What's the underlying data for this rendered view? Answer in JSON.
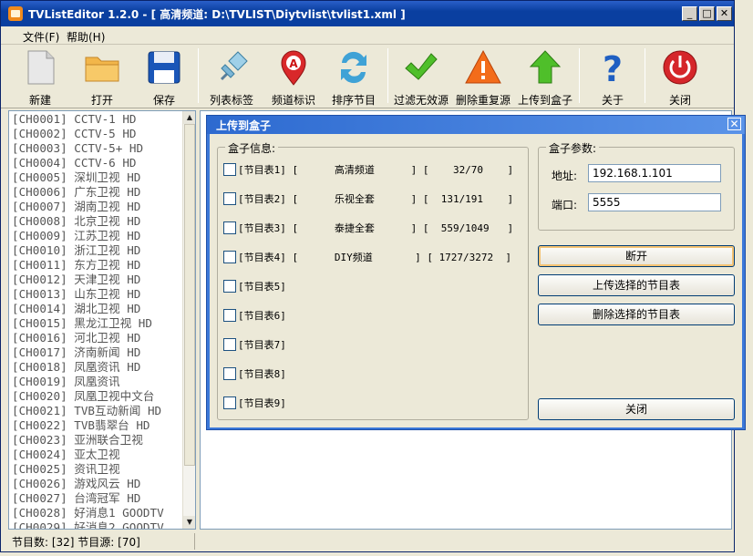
{
  "window": {
    "title": "TVListEditor 1.2.0 - [ 高清频道: D:\\TVLIST\\Diytvlist\\tvlist1.xml ]"
  },
  "menu": [
    {
      "label": "文件(F)"
    },
    {
      "label": "帮助(H)"
    }
  ],
  "toolbar": [
    {
      "label": "新建",
      "icon": "new-file-icon"
    },
    {
      "label": "打开",
      "icon": "open-folder-icon"
    },
    {
      "label": "保存",
      "icon": "save-disk-icon"
    },
    {
      "label": "列表标签",
      "icon": "pin-icon"
    },
    {
      "label": "频道标识",
      "icon": "marker-a-icon"
    },
    {
      "label": "排序节目",
      "icon": "sort-arrows-icon"
    },
    {
      "label": "过滤无效源",
      "icon": "checkmark-icon"
    },
    {
      "label": "删除重复源",
      "icon": "warning-icon"
    },
    {
      "label": "上传到盒子",
      "icon": "upload-arrow-icon"
    },
    {
      "label": "关于",
      "icon": "help-icon"
    },
    {
      "label": "关闭",
      "icon": "power-icon"
    }
  ],
  "channels": [
    "[CH0001] CCTV-1 HD",
    "[CH0002] CCTV-5 HD",
    "[CH0003] CCTV-5+ HD",
    "[CH0004] CCTV-6 HD",
    "[CH0005] 深圳卫视 HD",
    "[CH0006] 广东卫视 HD",
    "[CH0007] 湖南卫视 HD",
    "[CH0008] 北京卫视 HD",
    "[CH0009] 江苏卫视 HD",
    "[CH0010] 浙江卫视 HD",
    "[CH0011] 东方卫视 HD",
    "[CH0012] 天津卫视 HD",
    "[CH0013] 山东卫视 HD",
    "[CH0014] 湖北卫视 HD",
    "[CH0015] 黑龙江卫视 HD",
    "[CH0016] 河北卫视 HD",
    "[CH0017] 济南新闻 HD",
    "[CH0018] 凤凰资讯 HD",
    "[CH0019] 凤凰资讯",
    "[CH0020] 凤凰卫视中文台",
    "[CH0021] TVB互动新闻 HD",
    "[CH0022] TVB翡翠台 HD",
    "[CH0023] 亚洲联合卫视",
    "[CH0024] 亚太卫视",
    "[CH0025] 资讯卫视",
    "[CH0026] 游戏风云 HD",
    "[CH0027] 台湾冠军 HD",
    "[CH0028] 好消息1 GOODTV",
    "[CH0029] 好消息2 GOODTV"
  ],
  "status": {
    "text": "节目数: [32]  节目源: [70]"
  },
  "dialog": {
    "title": "上传到盒子",
    "box_info_title": "盒子信息:",
    "box_params_title": "盒子参数:",
    "lists": [
      {
        "label": "[节目表1] [      高清频道      ] [    32/70    ]",
        "checked": false
      },
      {
        "label": "[节目表2] [      乐视全套      ] [  131/191    ]",
        "checked": false
      },
      {
        "label": "[节目表3] [      泰捷全套      ] [  559/1049   ]",
        "checked": false
      },
      {
        "label": "[节目表4] [      DIY频道       ] [ 1727/3272  ]",
        "checked": false
      },
      {
        "label": "[节目表5]",
        "checked": false
      },
      {
        "label": "[节目表6]",
        "checked": false
      },
      {
        "label": "[节目表7]",
        "checked": false
      },
      {
        "label": "[节目表8]",
        "checked": false
      },
      {
        "label": "[节目表9]",
        "checked": false
      }
    ],
    "address_label": "地址:",
    "address_value": "192.168.1.101",
    "port_label": "端口:",
    "port_value": "5555",
    "disconnect_label": "断开",
    "upload_label": "上传选择的节目表",
    "delete_label": "删除选择的节目表",
    "close_label": "关闭"
  }
}
